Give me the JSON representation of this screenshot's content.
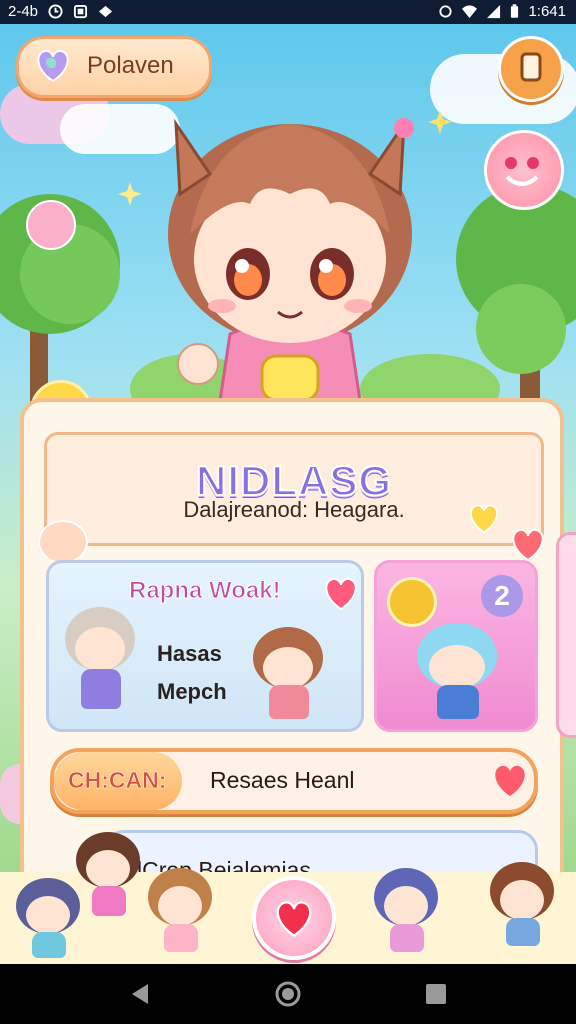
{
  "status_bar": {
    "left_text": "2-4b",
    "time": "1:641",
    "icons_left": [
      "clock-icon",
      "image-icon",
      "cloud-icon"
    ],
    "icons_right": [
      "alarm-icon",
      "wifi-icon",
      "signal-icon",
      "battery-icon"
    ]
  },
  "top_button": {
    "label": "Polaven",
    "icon": "heart-icon"
  },
  "menu_button": {
    "icon": "menu-icon"
  },
  "panel": {
    "title": "NIDLASG",
    "subtitle": "Dalajreanod: Heagara."
  },
  "card_left": {
    "title": "Rapna Woak!",
    "line1": "Hasas",
    "line2": "Mepch"
  },
  "card_right": {
    "badge_count": "2"
  },
  "action_bar": {
    "label": "CH:CAN:",
    "text": "Resaes Heanl"
  },
  "second_bar": {
    "text": "lCrop Beialemias"
  },
  "colors": {
    "title": "#8b6ee0",
    "accent_orange": "#f4a35c",
    "accent_pink": "#f08ad1"
  }
}
